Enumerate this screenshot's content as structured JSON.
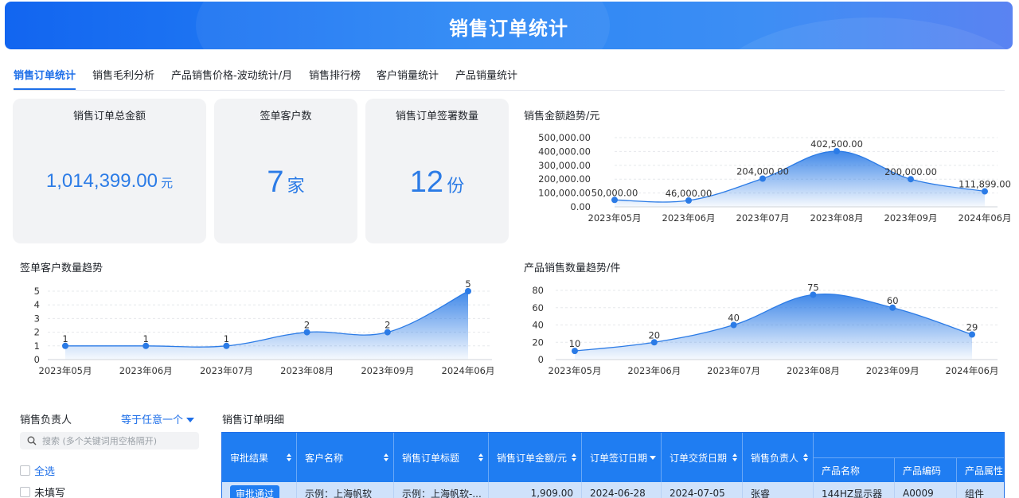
{
  "header": {
    "title": "销售订单统计"
  },
  "tabs": [
    {
      "label": "销售订单统计"
    },
    {
      "label": "销售毛利分析"
    },
    {
      "label": "产品销售价格-波动统计/月"
    },
    {
      "label": "销售排行榜"
    },
    {
      "label": "客户销量统计"
    },
    {
      "label": "产品销量统计"
    }
  ],
  "kpis": [
    {
      "title": "销售订单总金额",
      "value": "1,014,399.00",
      "unit": "元"
    },
    {
      "title": "签单客户数",
      "value": "7",
      "unit": "家"
    },
    {
      "title": "销售订单签署数量",
      "value": "12",
      "unit": "份"
    }
  ],
  "chart_data": [
    {
      "type": "area",
      "title": "销售金额趋势/元",
      "categories": [
        "2023年05月",
        "2023年06月",
        "2023年07月",
        "2023年08月",
        "2023年09月",
        "2024年06月"
      ],
      "values": [
        50000,
        46000,
        204000,
        402500,
        200000,
        111899
      ],
      "value_labels": [
        "50,000.00",
        "46,000.00",
        "204,000.00",
        "402,500.00",
        "200,000.00",
        "111,899.00"
      ],
      "yticks": [
        "0.00",
        "100,000.00",
        "200,000.00",
        "300,000.00",
        "400,000.00",
        "500,000.00"
      ],
      "ylim": [
        0,
        500000
      ],
      "color": "#2b7be6"
    },
    {
      "type": "area",
      "title": "签单客户数量趋势",
      "categories": [
        "2023年05月",
        "2023年06月",
        "2023年07月",
        "2023年08月",
        "2023年09月",
        "2024年06月"
      ],
      "values": [
        1,
        1,
        1,
        2,
        2,
        5
      ],
      "value_labels": [
        "1",
        "1",
        "1",
        "2",
        "2",
        "5"
      ],
      "yticks": [
        "0",
        "1",
        "2",
        "3",
        "4",
        "5"
      ],
      "ylim": [
        0,
        5
      ],
      "color": "#2b7be6"
    },
    {
      "type": "area",
      "title": "产品销售数量趋势/件",
      "categories": [
        "2023年05月",
        "2023年06月",
        "2023年07月",
        "2023年08月",
        "2023年09月",
        "2024年06月"
      ],
      "values": [
        10,
        20,
        40,
        75,
        60,
        29
      ],
      "value_labels": [
        "10",
        "20",
        "40",
        "75",
        "60",
        "29"
      ],
      "yticks": [
        "0",
        "20",
        "40",
        "60",
        "80"
      ],
      "ylim": [
        0,
        80
      ],
      "color": "#2b7be6"
    }
  ],
  "filter": {
    "label": "销售负责人",
    "operator": "等于任意一个",
    "search_placeholder": "搜索 (多个关键词用空格隔开)",
    "options": [
      {
        "label": "全选"
      },
      {
        "label": "未填写"
      }
    ]
  },
  "table": {
    "title": "销售订单明细",
    "headers": [
      "审批结果",
      "客户名称",
      "销售订单标题",
      "销售订单金额/元",
      "订单签订日期",
      "订单交货日期",
      "销售负责人"
    ],
    "sub_headers": [
      "产品名称",
      "产品编码",
      "产品属性"
    ],
    "rows": [
      {
        "approval": "审批通过",
        "customer": "示例：上海帆软",
        "title": "示例：上海帆软-...",
        "amount": "1,909.00",
        "sign_date": "2024-06-28",
        "delivery_date": "2024-07-05",
        "owner": "张睿",
        "product_name": "144HZ显示器",
        "product_code": "A0009",
        "product_attr": "组件"
      }
    ]
  }
}
